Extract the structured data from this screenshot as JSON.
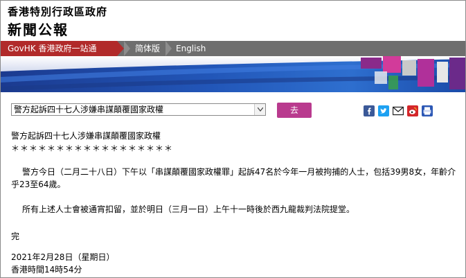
{
  "header": {
    "org_name": "香港特別行政區政府",
    "section_title": "新聞公報"
  },
  "nav": {
    "govhk_label": "GovHK 香港政府一站通",
    "simplified_label": "简体版",
    "english_label": "English"
  },
  "toolbar": {
    "select_value": "警方起訴四十七人涉嫌串謀顛覆國家政權",
    "go_label": "去",
    "share_icons": [
      "facebook-icon",
      "twitter-icon",
      "email-icon",
      "weibo-icon",
      "print-icon"
    ]
  },
  "article": {
    "heading": "警方起訴四十七人涉嫌串謀顛覆國家政權",
    "stars": "＊＊＊＊＊＊＊＊＊＊＊＊＊＊＊＊＊＊",
    "paragraph_1": "警方今日（二月二十八日）下午以「串謀顛覆國家政權罪」起訴47名於今年一月被拘捕的人士，包括39男8女，年齡介乎23至64歲。",
    "paragraph_2": "所有上述人士會被通宵扣留，並於明日（三月一日）上午十一時後於西九龍裁判法院提堂。",
    "end_mark": "完",
    "date": "2021年2月28日（星期日）",
    "time": "香港時間14時54分"
  },
  "colors": {
    "govhk_red": "#b12a2a",
    "nav_gray": "#6e6e6e",
    "go_button": "#b93a8e",
    "banner_blue": "#1c3f9c"
  }
}
